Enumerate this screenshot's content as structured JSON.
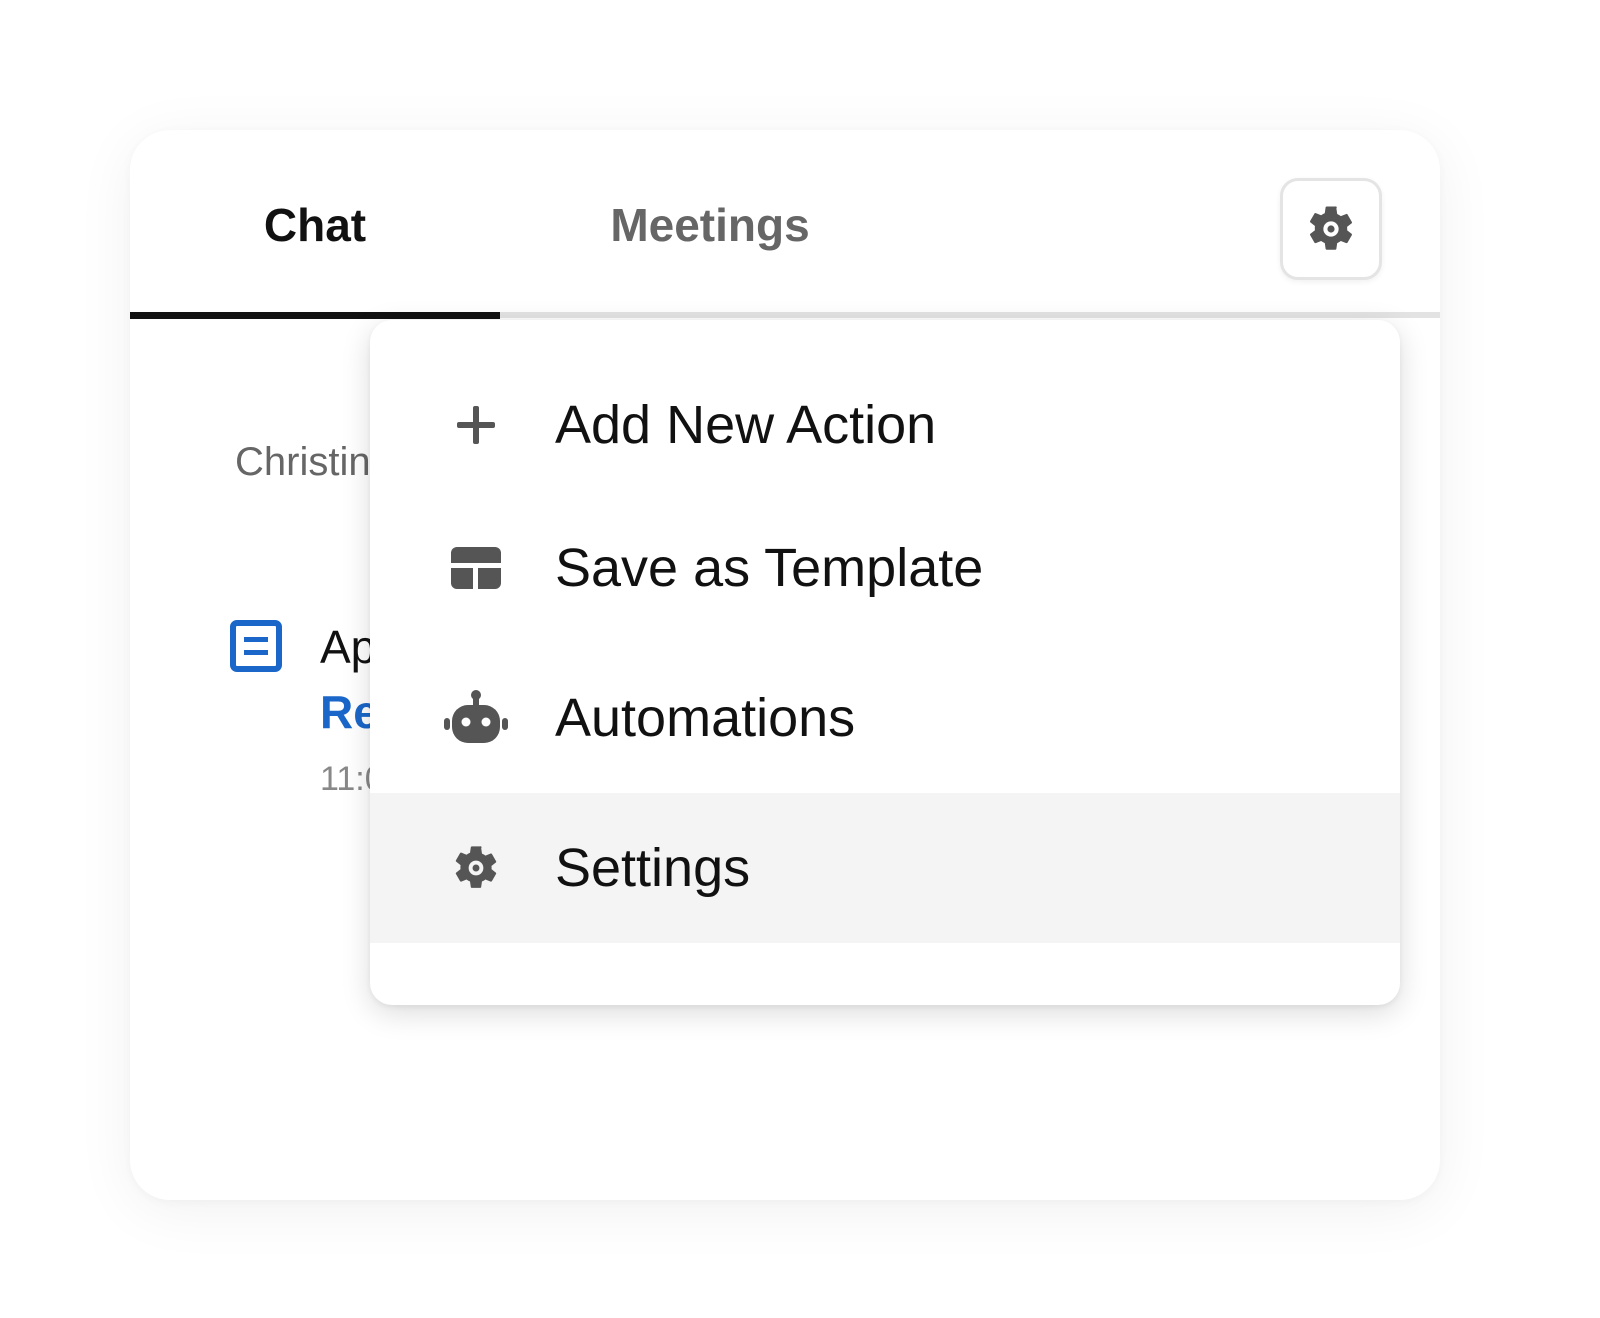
{
  "tabs": [
    {
      "label": "Chat",
      "active": true
    },
    {
      "label": "Meetings",
      "active": false
    }
  ],
  "conversation": {
    "sender": "Christin",
    "message_title": "Ap",
    "message_link": "Re",
    "message_time": "11:0"
  },
  "menu": {
    "items": [
      {
        "label": "Add New Action",
        "icon": "plus-icon"
      },
      {
        "label": "Save as Template",
        "icon": "template-icon"
      },
      {
        "label": "Automations",
        "icon": "robot-icon"
      },
      {
        "label": "Settings",
        "icon": "gear-icon",
        "highlighted": true
      }
    ]
  },
  "colors": {
    "active_tab": "#111111",
    "inactive_tab": "#666666",
    "link": "#1a66c9",
    "icon": "#555555",
    "highlight": "#f4f4f4"
  }
}
